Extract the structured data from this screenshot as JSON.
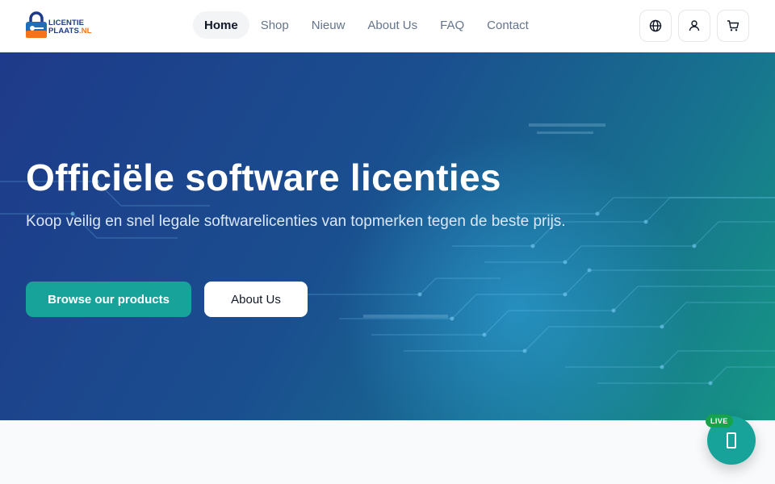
{
  "brand": {
    "logo_line1": "LICENTIE",
    "logo_line2": "PLAATS",
    "logo_suffix": ".NL",
    "colors": {
      "primary_blue": "#1e3a8a",
      "accent_orange": "#f97316",
      "teal": "#17a39a"
    }
  },
  "nav": {
    "items": [
      {
        "label": "Home",
        "active": true
      },
      {
        "label": "Shop",
        "active": false
      },
      {
        "label": "Nieuw",
        "active": false
      },
      {
        "label": "About Us",
        "active": false
      },
      {
        "label": "FAQ",
        "active": false
      },
      {
        "label": "Contact",
        "active": false
      }
    ]
  },
  "header_actions": {
    "icons": [
      "globe-icon",
      "user-icon",
      "cart-icon"
    ]
  },
  "hero": {
    "title": "Officiële software licenties",
    "subtitle": "Koop veilig en snel legale softwarelicenties van topmerken tegen de beste prijs.",
    "primary_button": "Browse our products",
    "secondary_button": "About Us"
  },
  "chat": {
    "badge": "LIVE",
    "icon": "chat-icon"
  }
}
